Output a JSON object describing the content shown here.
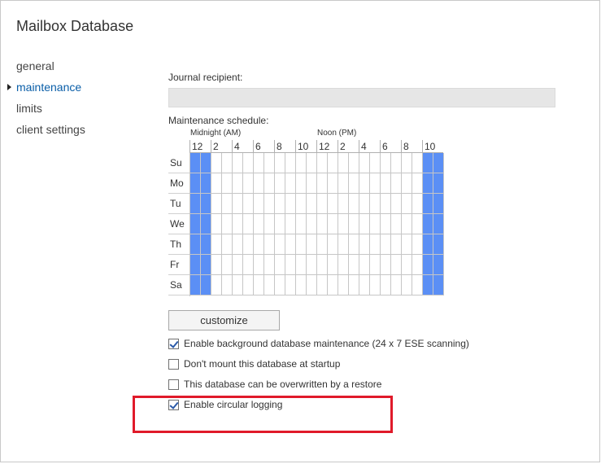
{
  "page": {
    "title": "Mailbox Database"
  },
  "nav": {
    "items": [
      {
        "label": "general",
        "active": false
      },
      {
        "label": "maintenance",
        "active": true
      },
      {
        "label": "limits",
        "active": false
      },
      {
        "label": "client settings",
        "active": false
      }
    ]
  },
  "journal": {
    "label": "Journal recipient:",
    "value": ""
  },
  "schedule": {
    "label": "Maintenance schedule:",
    "am_label": "Midnight (AM)",
    "pm_label": "Noon (PM)",
    "hour_labels": [
      "12",
      "2",
      "4",
      "6",
      "8",
      "10",
      "12",
      "2",
      "4",
      "6",
      "8",
      "10"
    ],
    "days": [
      "Su",
      "Mo",
      "Tu",
      "We",
      "Th",
      "Fr",
      "Sa"
    ],
    "slots_per_day": 24,
    "active_slots": [
      0,
      1,
      22,
      23
    ],
    "active_color": "#5b8ff5"
  },
  "customize": {
    "label": "customize"
  },
  "options": [
    {
      "label": "Enable background database maintenance (24 x 7 ESE scanning)",
      "checked": true
    },
    {
      "label": "Don't mount this database at startup",
      "checked": false
    },
    {
      "label": "This database can be overwritten by a restore",
      "checked": false
    },
    {
      "label": "Enable circular logging",
      "checked": true
    }
  ],
  "highlight": {
    "color": "#e01a2a"
  }
}
